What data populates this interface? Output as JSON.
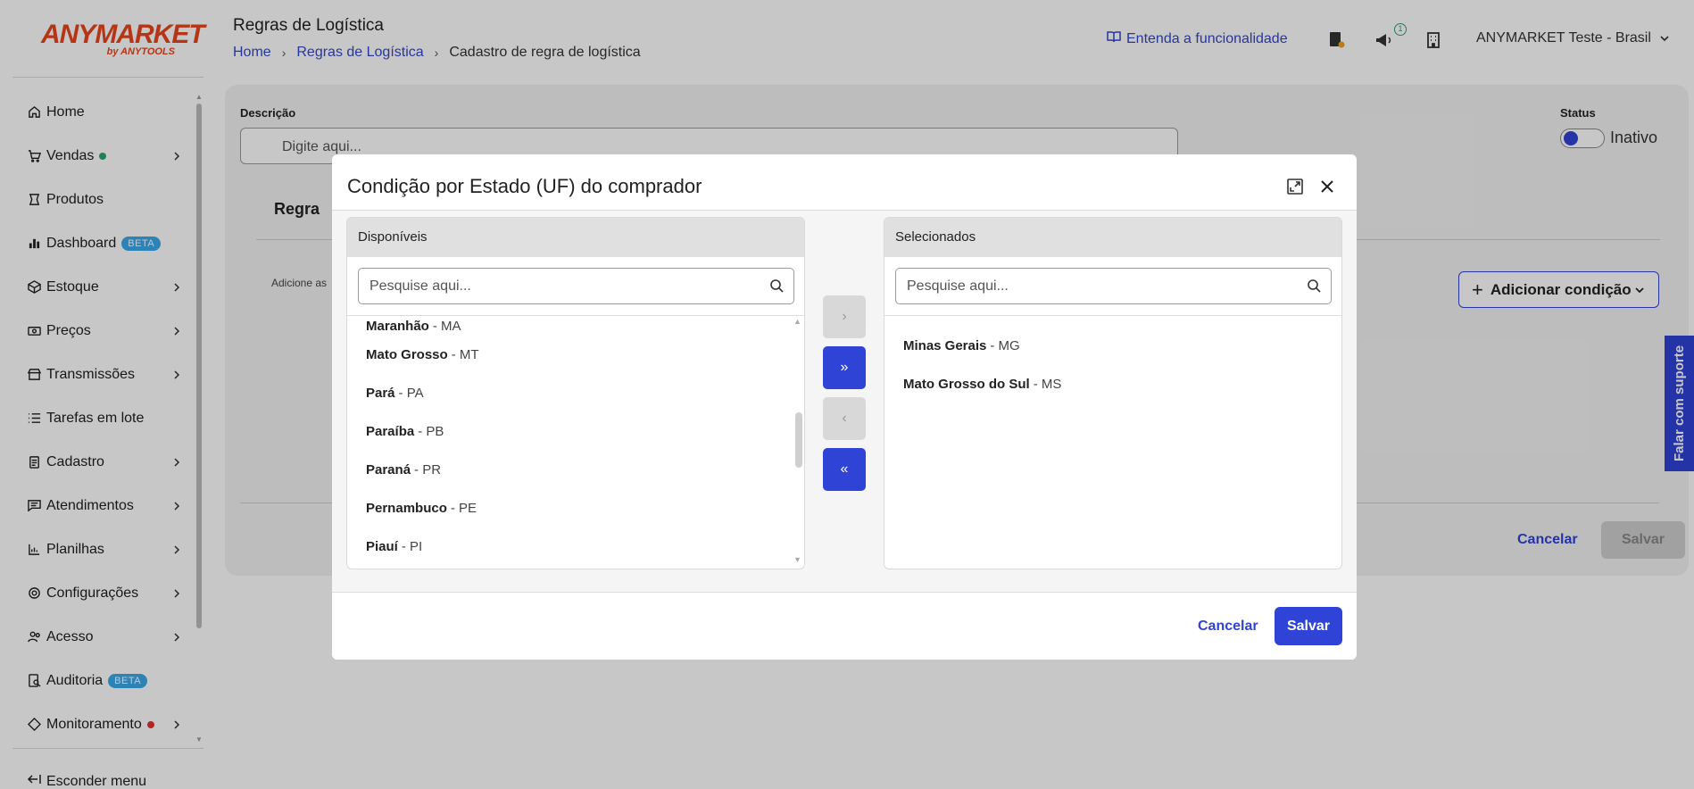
{
  "app": {
    "logo_main": "ANYMARKET",
    "logo_sub": "by ANYTOOLS"
  },
  "sidebar": {
    "items": [
      {
        "label": "Home",
        "icon": "home-icon",
        "chevron": false
      },
      {
        "label": "Vendas",
        "icon": "cart-icon",
        "chevron": true,
        "dot": "#2ea36e"
      },
      {
        "label": "Produtos",
        "icon": "tag-icon",
        "chevron": false
      },
      {
        "label": "Dashboard",
        "icon": "bar-chart-icon",
        "chevron": false,
        "badge": "BETA"
      },
      {
        "label": "Estoque",
        "icon": "box-icon",
        "chevron": true
      },
      {
        "label": "Preços",
        "icon": "money-icon",
        "chevron": true
      },
      {
        "label": "Transmissões",
        "icon": "store-icon",
        "chevron": true
      },
      {
        "label": "Tarefas em lote",
        "icon": "list-icon",
        "chevron": false
      },
      {
        "label": "Cadastro",
        "icon": "clipboard-icon",
        "chevron": true
      },
      {
        "label": "Atendimentos",
        "icon": "chat-icon",
        "chevron": true
      },
      {
        "label": "Planilhas",
        "icon": "spreadsheet-icon",
        "chevron": true
      },
      {
        "label": "Configurações",
        "icon": "gear-icon",
        "chevron": true
      },
      {
        "label": "Acesso",
        "icon": "users-icon",
        "chevron": true
      },
      {
        "label": "Auditoria",
        "icon": "audit-icon",
        "chevron": false,
        "badge": "BETA"
      },
      {
        "label": "Monitoramento",
        "icon": "diamond-icon",
        "chevron": true,
        "dot": "#e03131"
      }
    ],
    "hide_menu": "Esconder menu"
  },
  "header": {
    "title": "Regras de Logística",
    "breadcrumb": {
      "home": "Home",
      "section": "Regras de Logística",
      "current": "Cadastro de regra de logística"
    },
    "help_link": "Entenda a funcionalidade",
    "notification_count": "1",
    "account": "ANYMARKET Teste - Brasil"
  },
  "form": {
    "description_label": "Descrição",
    "description_placeholder": "Digite aqui...",
    "status_label": "Status",
    "status_value": "Inativo",
    "tab_label": "Regra",
    "add_hint": "Adicione as",
    "add_condition": "Adicionar condição",
    "cancel": "Cancelar",
    "save": "Salvar"
  },
  "support_tab": "Falar com suporte",
  "modal": {
    "title": "Condição por Estado (UF) do comprador",
    "available": {
      "header": "Disponíveis",
      "search_placeholder": "Pesquise aqui...",
      "items": [
        {
          "name": "Maranhão",
          "uf": "- MA"
        },
        {
          "name": "Mato Grosso",
          "uf": "- MT"
        },
        {
          "name": "Pará",
          "uf": "- PA"
        },
        {
          "name": "Paraíba",
          "uf": "- PB"
        },
        {
          "name": "Paraná",
          "uf": "- PR"
        },
        {
          "name": "Pernambuco",
          "uf": "- PE"
        },
        {
          "name": "Piauí",
          "uf": "- PI"
        }
      ]
    },
    "selected": {
      "header": "Selecionados",
      "search_placeholder": "Pesquise aqui...",
      "items": [
        {
          "name": "Minas Gerais",
          "uf": "- MG"
        },
        {
          "name": "Mato Grosso do Sul",
          "uf": "- MS"
        }
      ]
    },
    "transfer": {
      "move_one": "›",
      "move_all": "»",
      "remove_one": "‹",
      "remove_all": "«"
    },
    "cancel": "Cancelar",
    "save": "Salvar"
  },
  "colors": {
    "primary": "#2f43d6",
    "logo": "#e8461e",
    "beta_badge": "#3aa8e8"
  }
}
